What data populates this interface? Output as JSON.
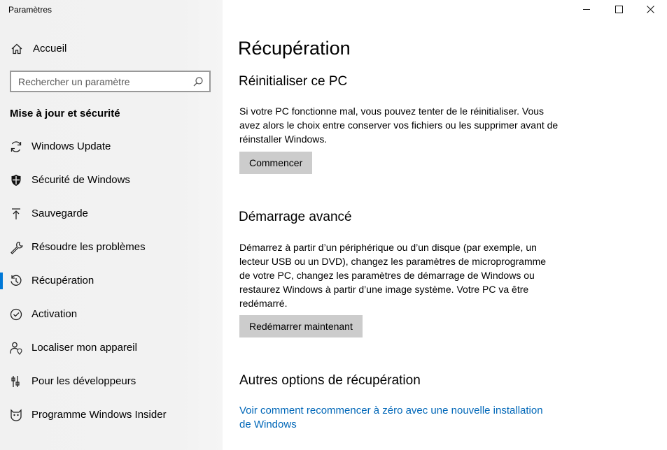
{
  "window": {
    "title": "Paramètres"
  },
  "sidebar": {
    "home_label": "Accueil",
    "search_placeholder": "Rechercher un paramètre",
    "section_title": "Mise à jour et sécurité",
    "items": [
      {
        "label": "Windows Update",
        "icon": "sync-icon"
      },
      {
        "label": "Sécurité de Windows",
        "icon": "shield-icon"
      },
      {
        "label": "Sauvegarde",
        "icon": "backup-arrow-icon"
      },
      {
        "label": "Résoudre les problèmes",
        "icon": "wrench-icon"
      },
      {
        "label": "Récupération",
        "icon": "history-icon",
        "active": true
      },
      {
        "label": "Activation",
        "icon": "check-circle-icon"
      },
      {
        "label": "Localiser mon appareil",
        "icon": "person-location-icon"
      },
      {
        "label": "Pour les développeurs",
        "icon": "developer-icon"
      },
      {
        "label": "Programme Windows Insider",
        "icon": "insider-cat-icon"
      }
    ]
  },
  "main": {
    "title": "Récupération",
    "reset": {
      "heading": "Réinitialiser ce PC",
      "description": "Si votre PC fonctionne mal, vous pouvez tenter de le réinitialiser. Vous avez alors le choix entre conserver vos fichiers ou les supprimer avant de réinstaller Windows.",
      "button": "Commencer"
    },
    "advanced": {
      "heading": "Démarrage avancé",
      "description": "Démarrez à partir d’un périphérique ou d’un disque (par exemple, un lecteur USB ou un DVD), changez les paramètres de microprogramme de votre PC, changez les paramètres de démarrage de Windows ou restaurez Windows à partir d’une image système. Votre PC va être redémarré.",
      "button": "Redémarrer maintenant"
    },
    "other": {
      "heading": "Autres options de récupération",
      "link": "Voir comment recommencer à zéro avec une nouvelle installation de Windows"
    }
  },
  "colors": {
    "accent": "#0078d7",
    "link": "#0067b8",
    "button": "#cccccc",
    "sidebar": "#f2f2f2"
  }
}
